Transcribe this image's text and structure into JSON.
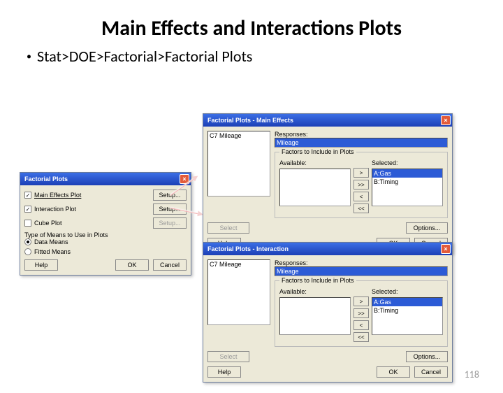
{
  "slide": {
    "title": "Main Effects and Interactions Plots",
    "bullet": "Stat>DOE>Factorial>Factorial Plots",
    "page": "118"
  },
  "dlg_main": {
    "title": "Factorial Plots",
    "opt_main": "Main Effects Plot",
    "opt_inter": "Interaction Plot",
    "opt_cube": "Cube Plot",
    "btn_setup": "Setup...",
    "type_label": "Type of Means to Use in Plots",
    "rb_data": "Data Means",
    "rb_fitted": "Fitted Means",
    "btn_help": "Help",
    "btn_ok": "OK",
    "btn_cancel": "Cancel"
  },
  "dlg_me": {
    "title": "Factorial Plots - Main Effects",
    "src_item": "C7    Mileage",
    "resp_label": "Responses:",
    "resp_val": "Mileage",
    "grp_label": "Factors to Include in Plots",
    "avail_label": "Available:",
    "sel_label": "Selected:",
    "sel_a": "A:Gas",
    "sel_b": "B:Timing",
    "mv_r": ">",
    "mv_rr": ">>",
    "mv_l": "<",
    "mv_ll": "<<",
    "btn_select": "Select",
    "btn_options": "Options...",
    "btn_help": "Help",
    "btn_ok": "OK",
    "btn_cancel": "Cancel"
  },
  "dlg_int": {
    "title": "Factorial Plots - Interaction",
    "src_item": "C7    Mileage",
    "resp_label": "Responses:",
    "resp_val": "Mileage",
    "grp_label": "Factors to Include in Plots",
    "avail_label": "Available:",
    "sel_label": "Selected:",
    "sel_a": "A:Gas",
    "sel_b": "B:Timing",
    "mv_r": ">",
    "mv_rr": ">>",
    "mv_l": "<",
    "mv_ll": "<<",
    "btn_select": "Select",
    "btn_options": "Options...",
    "btn_help": "Help",
    "btn_ok": "OK",
    "btn_cancel": "Cancel"
  }
}
